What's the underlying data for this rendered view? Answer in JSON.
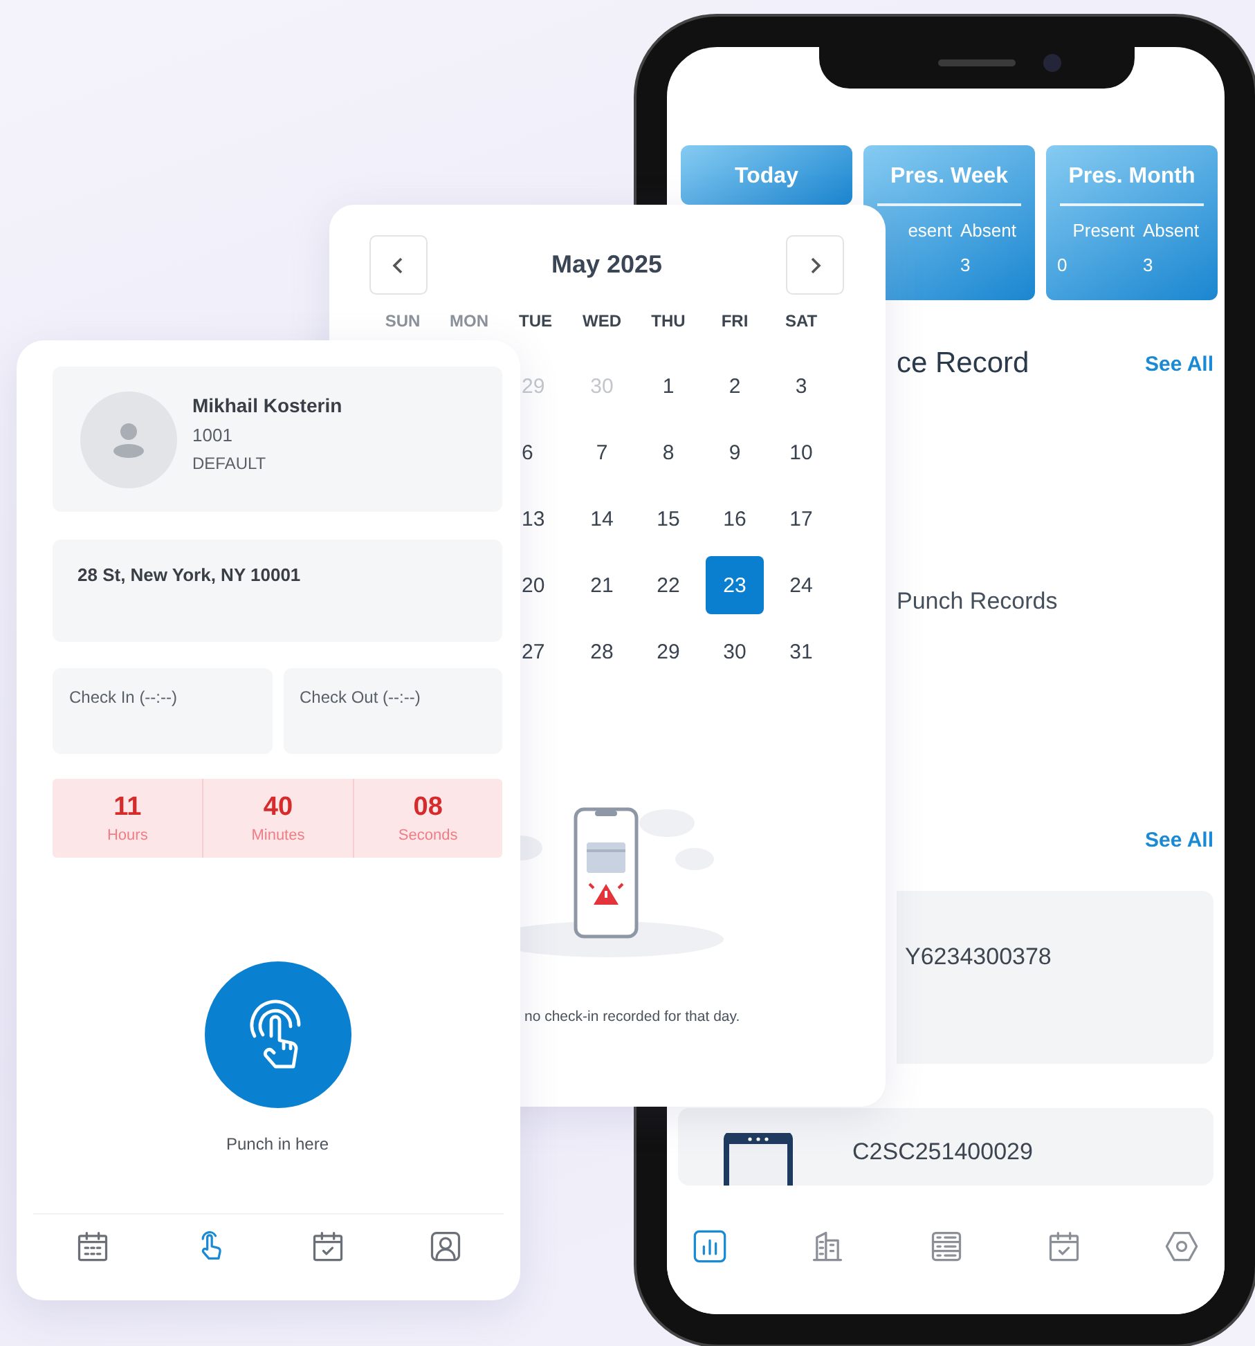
{
  "phone": {
    "stats": [
      {
        "title": "Today"
      },
      {
        "title": "Pres. Week",
        "columns": [
          {
            "label": "esent"
          },
          {
            "label": "Absent",
            "value": "3"
          }
        ]
      },
      {
        "title": "Pres. Month",
        "columns": [
          {
            "label": "Present",
            "value": "0"
          },
          {
            "label": "Absent",
            "value": "3"
          }
        ]
      }
    ],
    "record_title": "ce Record",
    "record_link": "See All",
    "empty_text": "Punch Records",
    "list_link": "See All",
    "records": [
      {
        "kind": "plain",
        "code": "Y6234300378"
      },
      {
        "kind": "device",
        "code": "C2SC251400029"
      }
    ],
    "nav": [
      {
        "selected": true
      },
      {
        "selected": false
      },
      {
        "selected": false
      },
      {
        "selected": false
      },
      {
        "selected": false
      }
    ]
  },
  "calendar": {
    "month": "May 2025",
    "weekdays": [
      "SUN",
      "MON",
      "TUE",
      "WED",
      "THU",
      "FRI",
      "SAT"
    ],
    "weeks": [
      [
        {
          "day": "29",
          "outside": true,
          "selected": false
        },
        {
          "day": "30",
          "outside": true,
          "selected": false
        },
        {
          "day": "1",
          "outside": false,
          "selected": false
        },
        {
          "day": "2",
          "outside": false,
          "selected": false
        },
        {
          "day": "3",
          "outside": false,
          "selected": false
        }
      ],
      [
        {
          "day": "6",
          "outside": false,
          "selected": false
        },
        {
          "day": "7",
          "outside": false,
          "selected": false
        },
        {
          "day": "8",
          "outside": false,
          "selected": false
        },
        {
          "day": "9",
          "outside": false,
          "selected": false
        },
        {
          "day": "10",
          "outside": false,
          "selected": false
        }
      ],
      [
        {
          "day": "13",
          "outside": false,
          "selected": false
        },
        {
          "day": "14",
          "outside": false,
          "selected": false
        },
        {
          "day": "15",
          "outside": false,
          "selected": false
        },
        {
          "day": "16",
          "outside": false,
          "selected": false
        },
        {
          "day": "17",
          "outside": false,
          "selected": false
        }
      ],
      [
        {
          "day": "20",
          "outside": false,
          "selected": false
        },
        {
          "day": "21",
          "outside": false,
          "selected": false
        },
        {
          "day": "22",
          "outside": false,
          "selected": false
        },
        {
          "day": "23",
          "outside": false,
          "selected": true
        },
        {
          "day": "24",
          "outside": false,
          "selected": false
        }
      ],
      [
        {
          "day": "27",
          "outside": false,
          "selected": false
        },
        {
          "day": "28",
          "outside": false,
          "selected": false
        },
        {
          "day": "29",
          "outside": false,
          "selected": false
        },
        {
          "day": "30",
          "outside": false,
          "selected": false
        },
        {
          "day": "31",
          "outside": false,
          "selected": false
        }
      ]
    ],
    "message": "no check-in recorded for that day."
  },
  "punch": {
    "name": "Mikhail Kosterin",
    "id": "1001",
    "group": "DEFAULT",
    "address": "28 St, New York, NY 10001",
    "check_in": "Check In (--:--)",
    "check_out": "Check Out (--:--)",
    "timer": [
      {
        "value": "11",
        "unit": "Hours"
      },
      {
        "value": "40",
        "unit": "Minutes"
      },
      {
        "value": "08",
        "unit": "Seconds"
      }
    ],
    "action": "Punch in here",
    "nav": [
      {
        "selected": false
      },
      {
        "selected": true
      },
      {
        "selected": false
      },
      {
        "selected": false
      }
    ]
  }
}
